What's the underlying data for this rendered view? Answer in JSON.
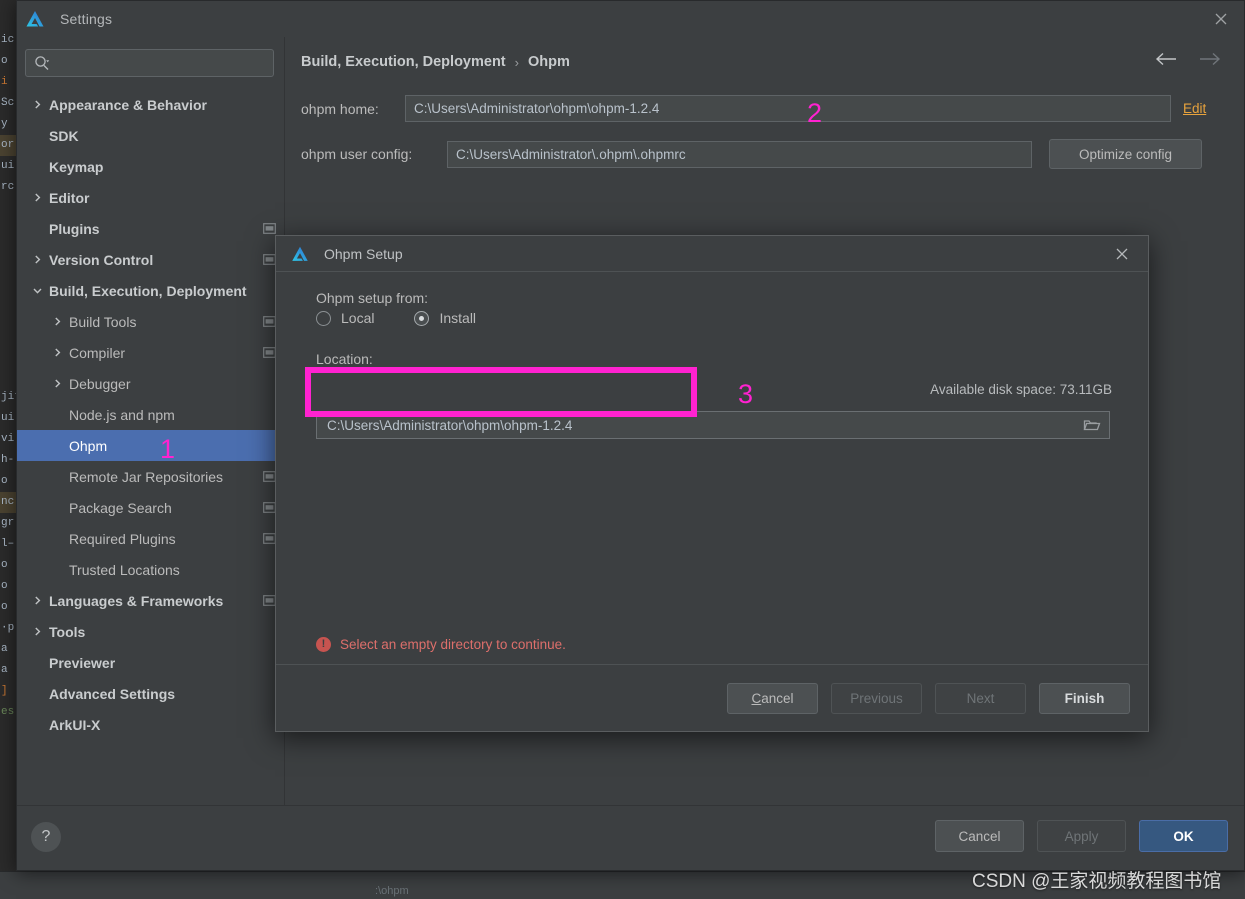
{
  "window": {
    "title": "Settings",
    "logo_icon": "deveco-logo-icon",
    "close_icon": "close-icon"
  },
  "search": {
    "placeholder": "",
    "value": "",
    "icon": "search-icon"
  },
  "sidebar": {
    "items": [
      {
        "label": "Appearance & Behavior",
        "arrow": "right",
        "depth": 0,
        "bold": true,
        "badge": false,
        "selected": false
      },
      {
        "label": "SDK",
        "arrow": "none",
        "depth": 0,
        "bold": true,
        "badge": false,
        "selected": false
      },
      {
        "label": "Keymap",
        "arrow": "none",
        "depth": 0,
        "bold": true,
        "badge": false,
        "selected": false
      },
      {
        "label": "Editor",
        "arrow": "right",
        "depth": 0,
        "bold": true,
        "badge": false,
        "selected": false
      },
      {
        "label": "Plugins",
        "arrow": "none",
        "depth": 0,
        "bold": true,
        "badge": true,
        "selected": false
      },
      {
        "label": "Version Control",
        "arrow": "right",
        "depth": 0,
        "bold": true,
        "badge": true,
        "selected": false
      },
      {
        "label": "Build, Execution, Deployment",
        "arrow": "down",
        "depth": 0,
        "bold": true,
        "badge": false,
        "selected": false
      },
      {
        "label": "Build Tools",
        "arrow": "right",
        "depth": 1,
        "bold": false,
        "badge": true,
        "selected": false
      },
      {
        "label": "Compiler",
        "arrow": "right",
        "depth": 1,
        "bold": false,
        "badge": true,
        "selected": false
      },
      {
        "label": "Debugger",
        "arrow": "right",
        "depth": 1,
        "bold": false,
        "badge": false,
        "selected": false
      },
      {
        "label": "Node.js and npm",
        "arrow": "none",
        "depth": 1,
        "bold": false,
        "badge": false,
        "selected": false
      },
      {
        "label": "Ohpm",
        "arrow": "none",
        "depth": 1,
        "bold": false,
        "badge": false,
        "selected": true
      },
      {
        "label": "Remote Jar Repositories",
        "arrow": "none",
        "depth": 1,
        "bold": false,
        "badge": true,
        "selected": false
      },
      {
        "label": "Package Search",
        "arrow": "none",
        "depth": 1,
        "bold": false,
        "badge": true,
        "selected": false
      },
      {
        "label": "Required Plugins",
        "arrow": "none",
        "depth": 1,
        "bold": false,
        "badge": true,
        "selected": false
      },
      {
        "label": "Trusted Locations",
        "arrow": "none",
        "depth": 1,
        "bold": false,
        "badge": false,
        "selected": false
      },
      {
        "label": "Languages & Frameworks",
        "arrow": "right",
        "depth": 0,
        "bold": true,
        "badge": true,
        "selected": false
      },
      {
        "label": "Tools",
        "arrow": "right",
        "depth": 0,
        "bold": true,
        "badge": false,
        "selected": false
      },
      {
        "label": "Previewer",
        "arrow": "none",
        "depth": 0,
        "bold": true,
        "badge": false,
        "selected": false
      },
      {
        "label": "Advanced Settings",
        "arrow": "none",
        "depth": 0,
        "bold": true,
        "badge": false,
        "selected": false
      },
      {
        "label": "ArkUI-X",
        "arrow": "none",
        "depth": 0,
        "bold": true,
        "badge": false,
        "selected": false
      }
    ]
  },
  "content": {
    "breadcrumb": {
      "parent": "Build, Execution, Deployment",
      "separator": "›",
      "current": "Ohpm"
    },
    "nav": {
      "back_icon": "arrow-left-icon",
      "forward_icon": "arrow-right-icon"
    },
    "ohpm_home": {
      "label": "ohpm home:",
      "value": "C:\\Users\\Administrator\\ohpm\\ohpm-1.2.4",
      "edit_link": "Edit"
    },
    "ohpm_user_config": {
      "label": "ohpm user config:",
      "value": "C:\\Users\\Administrator\\.ohpm\\.ohpmrc",
      "optimize_button": "Optimize config"
    }
  },
  "dialog": {
    "title": "Ohpm Setup",
    "logo_icon": "deveco-logo-icon",
    "close_icon": "close-icon",
    "setup_from_label": "Ohpm setup from:",
    "radios": [
      {
        "label": "Local",
        "checked": false
      },
      {
        "label": "Install",
        "checked": true
      }
    ],
    "location_label": "Location:",
    "location_value": "C:\\Users\\Administrator\\ohpm\\ohpm-1.2.4",
    "browse_icon": "folder-icon",
    "disk_space": "Available disk space: 73.11GB",
    "error": {
      "icon": "error-icon",
      "text": "Select an empty directory to continue."
    },
    "buttons": [
      {
        "label": "Cancel",
        "mnemonic": "C",
        "state": "enabled"
      },
      {
        "label": "Previous",
        "mnemonic": "",
        "state": "disabled"
      },
      {
        "label": "Next",
        "mnemonic": "",
        "state": "disabled"
      },
      {
        "label": "Finish",
        "mnemonic": "",
        "state": "default"
      }
    ]
  },
  "bottom_bar": {
    "help_label": "?",
    "buttons": [
      {
        "label": "Cancel",
        "state": "enabled"
      },
      {
        "label": "Apply",
        "state": "disabled"
      },
      {
        "label": "OK",
        "state": "primary"
      }
    ]
  },
  "annotations": {
    "one": "1",
    "two": "2",
    "three": "3"
  },
  "watermark": "CSDN @王家视频教程图书馆",
  "colors": {
    "accent_blue": "#4b6eaf",
    "primary_button": "#365880",
    "link_orange": "#e8a33d",
    "error_red": "#dd6f6b",
    "annotation_magenta": "#ff22d0",
    "window_bg": "#3c3f41"
  }
}
